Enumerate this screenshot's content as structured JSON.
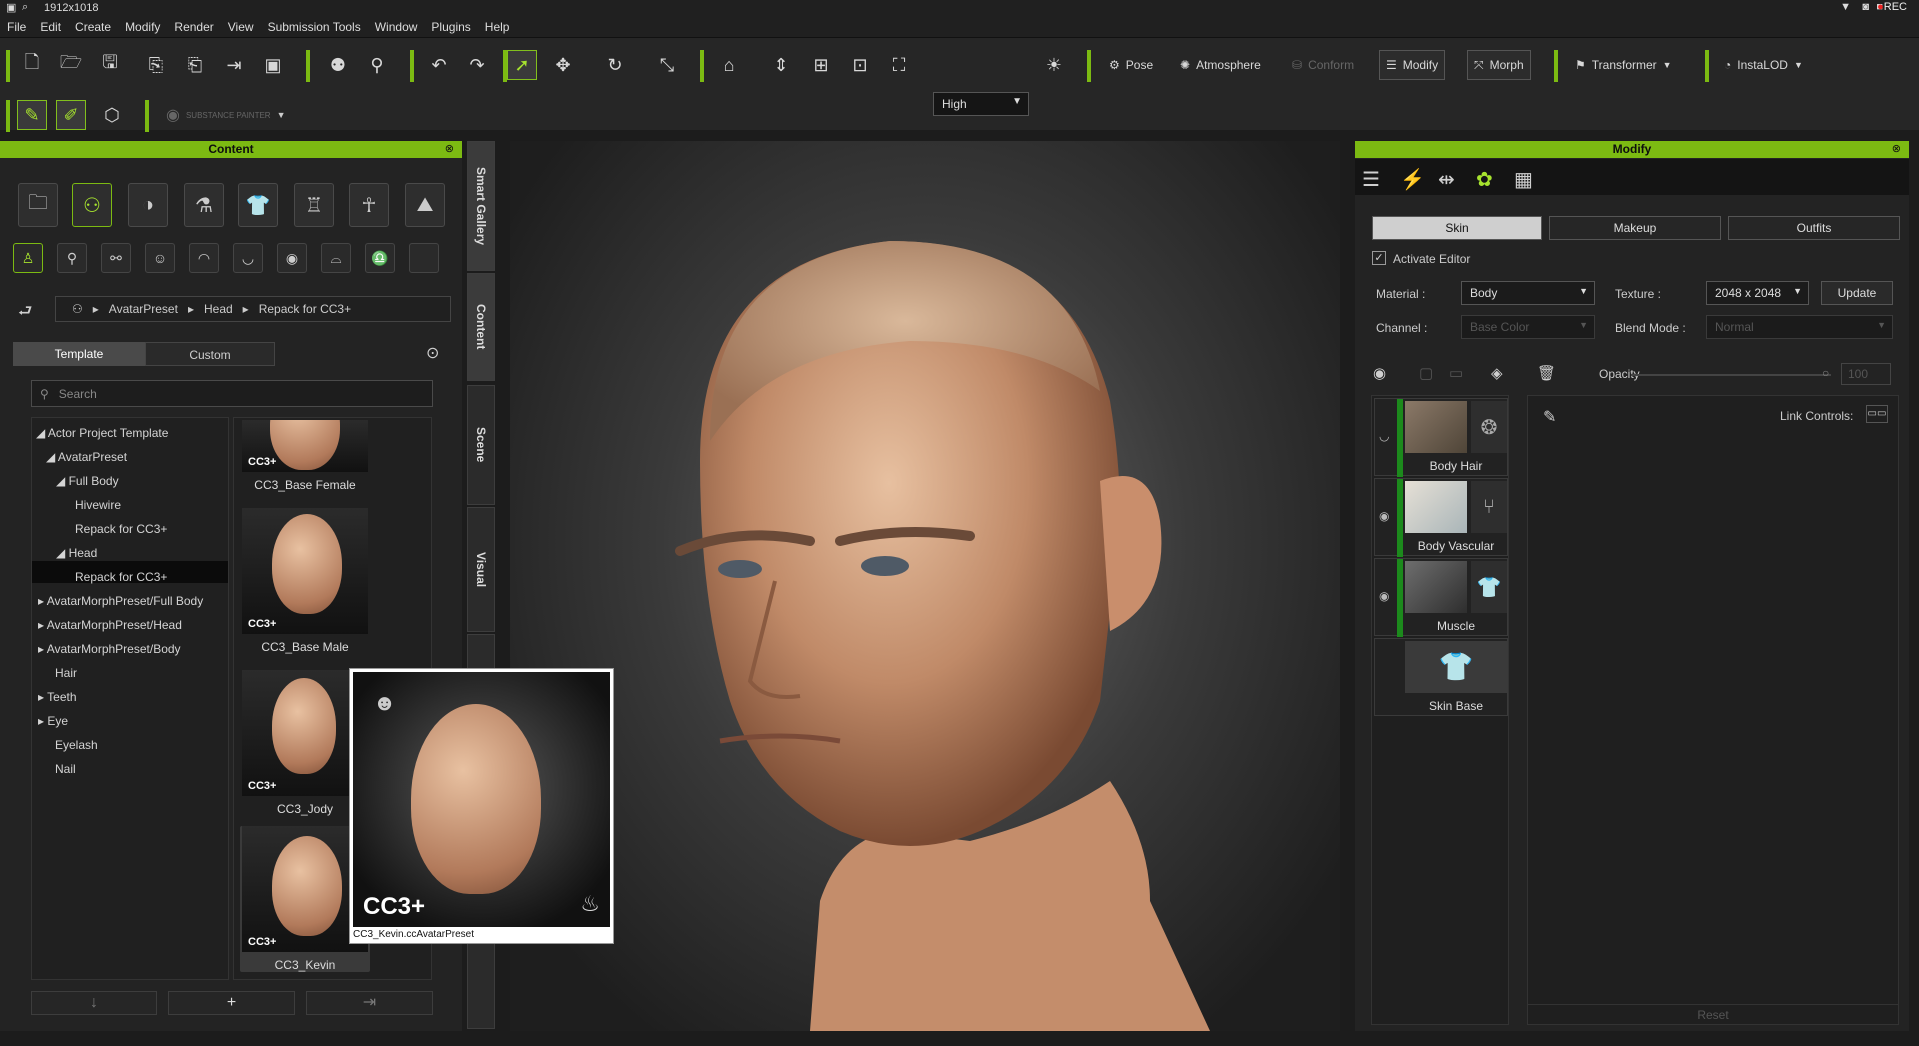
{
  "window": {
    "title": "1912x1018",
    "rec": "REC"
  },
  "menu": [
    "File",
    "Edit",
    "Create",
    "Modify",
    "Render",
    "View",
    "Submission Tools",
    "Window",
    "Plugins",
    "Help"
  ],
  "toolbar": {
    "quality": "High",
    "pose": "Pose",
    "atmosphere": "Atmosphere",
    "conform": "Conform",
    "modify": "Modify",
    "morph": "Morph",
    "transformer": "Transformer",
    "instalod": "InstaLOD",
    "substance": "SUBSTANCE PAINTER"
  },
  "content": {
    "title": "Content",
    "breadcrumb": [
      "AvatarPreset",
      "Head",
      "Repack for CC3+"
    ],
    "tabs": [
      "Template",
      "Custom"
    ],
    "search_placeholder": "Search",
    "tree": [
      "Actor Project Template",
      "AvatarPreset",
      "Full Body",
      "Hivewire",
      "Repack for CC3+",
      "Head",
      "Repack for CC3+",
      "AvatarMorphPreset/Full Body",
      "AvatarMorphPreset/Head",
      "AvatarMorphPreset/Body",
      "Hair",
      "Teeth",
      "Eye",
      "Eyelash",
      "Nail"
    ],
    "items": [
      "CC3_Base Female",
      "CC3_Base Male",
      "CC3_Jody",
      "CC3_Kevin"
    ],
    "badge": "CC3+",
    "tooltip": "CC3_Kevin.ccAvatarPreset",
    "side_tabs": [
      "Smart Gallery",
      "Content",
      "Scene",
      "Visual"
    ]
  },
  "modify": {
    "title": "Modify",
    "tabs": [
      "Skin",
      "Makeup",
      "Outfits"
    ],
    "activate_editor": "Activate Editor",
    "material_label": "Material :",
    "material_value": "Body",
    "texture_label": "Texture :",
    "texture_value": "2048 x 2048",
    "update": "Update",
    "channel_label": "Channel :",
    "channel_value": "Base Color",
    "blend_label": "Blend Mode :",
    "blend_value": "Normal",
    "opacity_label": "Opacity",
    "opacity_value": "100",
    "link_controls": "Link Controls:",
    "layers": [
      "Body Hair",
      "Body Vascular",
      "Muscle",
      "Skin Base"
    ],
    "reset": "Reset"
  }
}
